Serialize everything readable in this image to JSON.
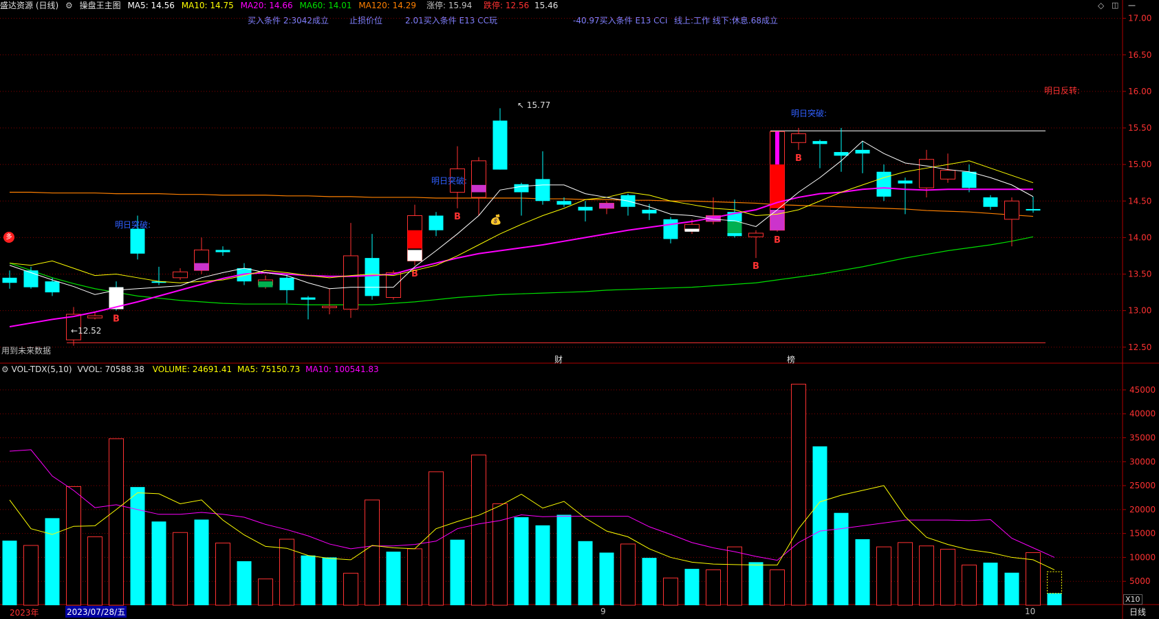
{
  "header": {
    "title": "盛达资源 (日线)",
    "indicator": "操盘王主图",
    "ma5": "MA5: 14.56",
    "ma10": "MA10: 14.75",
    "ma20": "MA20: 14.66",
    "ma60": "MA60: 14.01",
    "ma120": "MA120: 14.29",
    "limit_up": "涨停: 15.94",
    "limit_down": "跌停: 12.56",
    "right_val": "15.46"
  },
  "annotations": {
    "buy_cond_1": "买入条件 2:3042成立",
    "stop_loss": "止损价位",
    "buy_cond_2": "2.01买入条件 E13 CC玩",
    "buy_cond_3": "-40.97买入条件 E13 CCI",
    "line_state": "线上:工作 线下:休息.68成立",
    "tomorrow_reversal": "明日反转:",
    "tomorrow_break": "明日突破:",
    "future_data": "用到未来数据",
    "cai": "财",
    "bang": "榜",
    "high_label": "15.77",
    "low_label": "12.52",
    "duo": "多"
  },
  "volume_header": {
    "name": "VOL-TDX(5,10)",
    "vvol": "VVOL: 70588.38",
    "volume": "VOLUME: 24691.41",
    "ma5": "MA5: 75150.73",
    "ma10": "MA10: 100541.83"
  },
  "bottom": {
    "year": "2023年",
    "date": "2023/07/28/五",
    "month9": "9",
    "month10": "10",
    "period": "日线",
    "x10": "X10"
  },
  "colors": {
    "up": "#ff3232",
    "down": "#00ffff",
    "ma5": "#ffffff",
    "ma10": "#ffff00",
    "ma20": "#ff00ff",
    "ma60": "#00e000",
    "ma120": "#ff8000",
    "grid": "#8b0000"
  },
  "chart_data": [
    {
      "type": "candlestick",
      "title": "盛达资源 (日线)",
      "ylim": [
        12.3,
        17.1
      ],
      "y_ticks": [
        12.5,
        13.0,
        13.5,
        14.0,
        14.5,
        15.0,
        15.5,
        16.0,
        16.5,
        17.0
      ],
      "y_tick_labels": [
        "12.50",
        "13.00",
        "13.50",
        "14.00",
        "14.50",
        "15.00",
        "15.50",
        "16.00",
        "16.50",
        "17.00"
      ],
      "candles": [
        {
          "o": 13.45,
          "c": 13.38,
          "h": 13.55,
          "l": 13.3
        },
        {
          "o": 13.55,
          "c": 13.32,
          "h": 13.6,
          "l": 13.3
        },
        {
          "o": 13.4,
          "c": 13.25,
          "h": 13.45,
          "l": 13.2
        },
        {
          "o": 12.6,
          "c": 12.95,
          "h": 13.05,
          "l": 12.52
        },
        {
          "o": 12.9,
          "c": 12.93,
          "h": 12.98,
          "l": 12.88
        },
        {
          "o": 13.32,
          "c": 13.02,
          "h": 13.4,
          "l": 13.0
        },
        {
          "o": 14.12,
          "c": 13.78,
          "h": 14.3,
          "l": 13.7
        },
        {
          "o": 13.4,
          "c": 13.38,
          "h": 13.6,
          "l": 13.35
        },
        {
          "o": 13.45,
          "c": 13.53,
          "h": 13.58,
          "l": 13.42
        },
        {
          "o": 13.55,
          "c": 13.83,
          "h": 14.0,
          "l": 13.5
        },
        {
          "o": 13.83,
          "c": 13.8,
          "h": 13.88,
          "l": 13.75
        },
        {
          "o": 13.58,
          "c": 13.4,
          "h": 13.65,
          "l": 13.35
        },
        {
          "o": 13.35,
          "c": 13.42,
          "h": 13.48,
          "l": 13.3
        },
        {
          "o": 13.45,
          "c": 13.28,
          "h": 13.5,
          "l": 13.1
        },
        {
          "o": 13.18,
          "c": 13.15,
          "h": 13.2,
          "l": 12.88
        },
        {
          "o": 13.04,
          "c": 13.06,
          "h": 13.3,
          "l": 12.95
        },
        {
          "o": 13.02,
          "c": 13.75,
          "h": 14.2,
          "l": 12.9
        },
        {
          "o": 13.72,
          "c": 13.2,
          "h": 14.05,
          "l": 13.15
        },
        {
          "o": 13.18,
          "c": 13.52,
          "h": 13.55,
          "l": 13.15
        },
        {
          "o": 13.68,
          "c": 14.3,
          "h": 14.45,
          "l": 13.62
        },
        {
          "o": 14.3,
          "c": 14.1,
          "h": 14.35,
          "l": 14.02
        },
        {
          "o": 14.62,
          "c": 14.94,
          "h": 15.25,
          "l": 14.4
        },
        {
          "o": 14.55,
          "c": 15.05,
          "h": 15.1,
          "l": 14.3
        },
        {
          "o": 15.6,
          "c": 14.93,
          "h": 15.77,
          "l": 14.93
        },
        {
          "o": 14.73,
          "c": 14.62,
          "h": 14.75,
          "l": 14.3
        },
        {
          "o": 14.8,
          "c": 14.5,
          "h": 15.18,
          "l": 14.45
        },
        {
          "o": 14.5,
          "c": 14.45,
          "h": 14.55,
          "l": 14.42
        },
        {
          "o": 14.42,
          "c": 14.37,
          "h": 14.5,
          "l": 14.22
        },
        {
          "o": 14.4,
          "c": 14.47,
          "h": 14.5,
          "l": 14.32
        },
        {
          "o": 14.58,
          "c": 14.42,
          "h": 14.6,
          "l": 14.3
        },
        {
          "o": 14.38,
          "c": 14.33,
          "h": 14.46,
          "l": 14.24
        },
        {
          "o": 14.25,
          "c": 13.98,
          "h": 14.28,
          "l": 13.92
        },
        {
          "o": 14.1,
          "c": 14.18,
          "h": 14.25,
          "l": 14.05
        },
        {
          "o": 14.22,
          "c": 14.3,
          "h": 14.55,
          "l": 14.18
        },
        {
          "o": 14.35,
          "c": 14.02,
          "h": 14.52,
          "l": 14.0
        },
        {
          "o": 14.01,
          "c": 14.06,
          "h": 14.1,
          "l": 13.72
        },
        {
          "o": 14.1,
          "c": 15.45,
          "h": 15.45,
          "l": 14.08
        },
        {
          "o": 15.3,
          "c": 15.42,
          "h": 15.5,
          "l": 15.2
        },
        {
          "o": 15.32,
          "c": 15.28,
          "h": 15.34,
          "l": 14.95
        },
        {
          "o": 15.17,
          "c": 15.12,
          "h": 15.5,
          "l": 14.9
        },
        {
          "o": 15.2,
          "c": 15.15,
          "h": 15.32,
          "l": 14.88
        },
        {
          "o": 14.9,
          "c": 14.56,
          "h": 15.0,
          "l": 14.5
        },
        {
          "o": 14.78,
          "c": 14.74,
          "h": 14.82,
          "l": 14.32
        },
        {
          "o": 14.68,
          "c": 15.07,
          "h": 15.2,
          "l": 14.55
        },
        {
          "o": 14.8,
          "c": 14.92,
          "h": 15.15,
          "l": 14.75
        },
        {
          "o": 14.9,
          "c": 14.68,
          "h": 15.0,
          "l": 14.62
        },
        {
          "o": 14.55,
          "c": 14.42,
          "h": 14.58,
          "l": 14.38
        },
        {
          "o": 14.25,
          "c": 14.5,
          "h": 14.55,
          "l": 13.88
        },
        {
          "o": 14.39,
          "c": 14.37,
          "h": 14.56,
          "l": 14.34
        }
      ],
      "series": [
        {
          "name": "MA5",
          "values": [
            13.62,
            13.52,
            13.42,
            13.33,
            13.22,
            13.28,
            13.3,
            13.32,
            13.34,
            13.45,
            13.52,
            13.58,
            13.52,
            13.48,
            13.38,
            13.3,
            13.32,
            13.32,
            13.32,
            13.6,
            13.82,
            14.05,
            14.3,
            14.65,
            14.7,
            14.72,
            14.72,
            14.6,
            14.55,
            14.5,
            14.42,
            14.32,
            14.3,
            14.25,
            14.23,
            14.15,
            14.38,
            14.62,
            14.82,
            15.05,
            15.32,
            15.15,
            15.02,
            14.98,
            14.93,
            14.9,
            14.82,
            14.72,
            14.56
          ]
        },
        {
          "name": "MA10",
          "values": [
            13.65,
            13.62,
            13.68,
            13.58,
            13.48,
            13.5,
            13.45,
            13.4,
            13.38,
            13.4,
            13.42,
            13.48,
            13.55,
            13.52,
            13.48,
            13.45,
            13.48,
            13.5,
            13.48,
            13.55,
            13.62,
            13.75,
            13.9,
            14.05,
            14.18,
            14.3,
            14.4,
            14.52,
            14.55,
            14.62,
            14.58,
            14.5,
            14.45,
            14.4,
            14.38,
            14.3,
            14.32,
            14.38,
            14.5,
            14.62,
            14.72,
            14.82,
            14.9,
            14.95,
            15.0,
            15.05,
            14.95,
            14.85,
            14.75
          ]
        },
        {
          "name": "MA20",
          "values": [
            12.78,
            12.83,
            12.88,
            12.92,
            12.98,
            13.05,
            13.12,
            13.2,
            13.28,
            13.36,
            13.44,
            13.5,
            13.52,
            13.5,
            13.48,
            13.47,
            13.47,
            13.48,
            13.5,
            13.58,
            13.65,
            13.72,
            13.78,
            13.82,
            13.86,
            13.9,
            13.95,
            14.0,
            14.05,
            14.1,
            14.14,
            14.18,
            14.22,
            14.27,
            14.33,
            14.38,
            14.48,
            14.55,
            14.6,
            14.62,
            14.66,
            14.68,
            14.66,
            14.65,
            14.66,
            14.66,
            14.66,
            14.66,
            14.66
          ]
        },
        {
          "name": "MA60",
          "values": [
            13.65,
            13.55,
            13.45,
            13.37,
            13.3,
            13.25,
            13.2,
            13.17,
            13.14,
            13.12,
            13.1,
            13.09,
            13.09,
            13.09,
            13.08,
            13.08,
            13.08,
            13.08,
            13.1,
            13.12,
            13.15,
            13.18,
            13.2,
            13.22,
            13.23,
            13.24,
            13.25,
            13.26,
            13.28,
            13.29,
            13.3,
            13.31,
            13.32,
            13.34,
            13.36,
            13.38,
            13.42,
            13.46,
            13.5,
            13.55,
            13.6,
            13.66,
            13.72,
            13.77,
            13.82,
            13.86,
            13.9,
            13.95,
            14.01
          ]
        },
        {
          "name": "MA120",
          "values": [
            14.62,
            14.62,
            14.61,
            14.61,
            14.61,
            14.6,
            14.6,
            14.6,
            14.59,
            14.59,
            14.58,
            14.58,
            14.58,
            14.57,
            14.57,
            14.56,
            14.56,
            14.55,
            14.55,
            14.55,
            14.54,
            14.54,
            14.54,
            14.54,
            14.54,
            14.53,
            14.53,
            14.52,
            14.52,
            14.51,
            14.51,
            14.5,
            14.5,
            14.49,
            14.48,
            14.47,
            14.45,
            14.44,
            14.43,
            14.42,
            14.41,
            14.4,
            14.39,
            14.37,
            14.36,
            14.35,
            14.33,
            14.31,
            14.29
          ]
        }
      ]
    },
    {
      "type": "bar",
      "title": "VOL-TDX(5,10)",
      "ylim": [
        0,
        47000
      ],
      "y_ticks": [
        5000,
        10000,
        15000,
        20000,
        25000,
        30000,
        35000,
        40000,
        45000
      ],
      "y_tick_labels": [
        "5000",
        "10000",
        "15000",
        "20000",
        "25000",
        "30000",
        "35000",
        "40000",
        "45000"
      ],
      "values": [
        13500,
        12500,
        18200,
        24800,
        14300,
        34800,
        24700,
        17500,
        15200,
        17900,
        13000,
        9200,
        5500,
        13800,
        10400,
        10000,
        6700,
        22000,
        11200,
        11800,
        27900,
        13700,
        31400,
        21200,
        18400,
        16700,
        18900,
        13400,
        11000,
        12800,
        9900,
        5700,
        7600,
        7400,
        12200,
        9000,
        7400,
        46200,
        33200,
        19300,
        13800,
        12200,
        13100,
        12400,
        11700,
        8400,
        8900,
        6800,
        11000,
        2500
      ],
      "up": [
        false,
        true,
        false,
        true,
        true,
        true,
        false,
        false,
        true,
        false,
        true,
        false,
        true,
        true,
        false,
        false,
        true,
        true,
        false,
        true,
        true,
        false,
        true,
        true,
        false,
        false,
        false,
        false,
        false,
        true,
        false,
        true,
        false,
        true,
        true,
        false,
        true,
        true,
        false,
        false,
        false,
        true,
        true,
        true,
        true,
        true,
        false,
        false,
        true,
        false
      ],
      "series": [
        {
          "name": "MA5",
          "values": [
            22000,
            16000,
            14800,
            16500,
            16600,
            20000,
            23500,
            23300,
            21200,
            22000,
            17800,
            14700,
            12300,
            11900,
            10400,
            9800,
            9500,
            12500,
            12000,
            11800,
            16000,
            17500,
            18800,
            20800,
            23200,
            20300,
            21700,
            18200,
            15500,
            14300,
            11800,
            10000,
            9000,
            8600,
            8500,
            8400,
            8400,
            16000,
            21600,
            23000,
            24000,
            25000,
            18500,
            14200,
            12700,
            11600,
            11000,
            10000,
            9500,
            7400
          ]
        },
        {
          "name": "MA10",
          "values": [
            32200,
            32500,
            27000,
            24000,
            20400,
            21000,
            20000,
            19000,
            19000,
            19400,
            19000,
            18400,
            16900,
            15800,
            14500,
            12800,
            11800,
            12400,
            12400,
            12700,
            13400,
            16000,
            17000,
            17700,
            18900,
            18500,
            18600,
            18600,
            18600,
            18600,
            16400,
            14800,
            13100,
            12000,
            11200,
            10200,
            9400,
            13100,
            15500,
            16000,
            16600,
            17200,
            17800,
            17800,
            17800,
            17700,
            17900,
            14000,
            12000,
            10000
          ]
        }
      ]
    }
  ]
}
